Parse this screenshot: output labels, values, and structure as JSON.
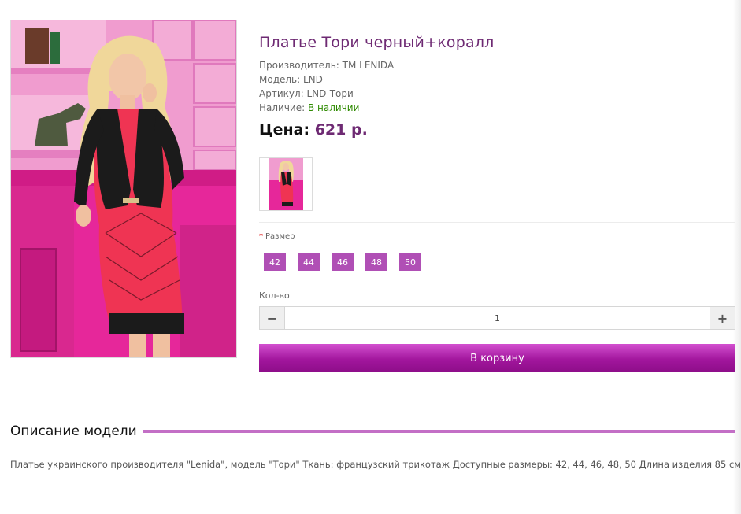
{
  "product": {
    "title": "Платье Тори черный+коралл",
    "manufacturer": "Производитель: TM LENIDA",
    "model": "Модель: LND",
    "sku": "Артикул: LND-Тори",
    "availability_label": "Наличие:",
    "availability_value": "В наличии",
    "price_label": "Цена:",
    "price_value": "621 р."
  },
  "options": {
    "size_label": "Размер",
    "required_mark": "*",
    "sizes": [
      "42",
      "44",
      "46",
      "48",
      "50"
    ]
  },
  "quantity": {
    "label": "Кол-во",
    "value": "1",
    "minus_icon": "minus-icon",
    "plus_icon": "plus-icon"
  },
  "cart": {
    "button_label": "В корзину"
  },
  "description": {
    "heading": "Описание модели",
    "text": "Платье украинского производителя \"Lenida\", модель \"Тори\" Ткань: французский трикотаж Доступные размеры: 42, 44, 46, 48, 50 Длина изделия 85 см"
  },
  "colors": {
    "title": "#6e2a73",
    "size_button": "#b04fb5",
    "cart_button": "#a2169d",
    "heading_line": "#c36fc6",
    "in_stock": "#2e8a00"
  }
}
